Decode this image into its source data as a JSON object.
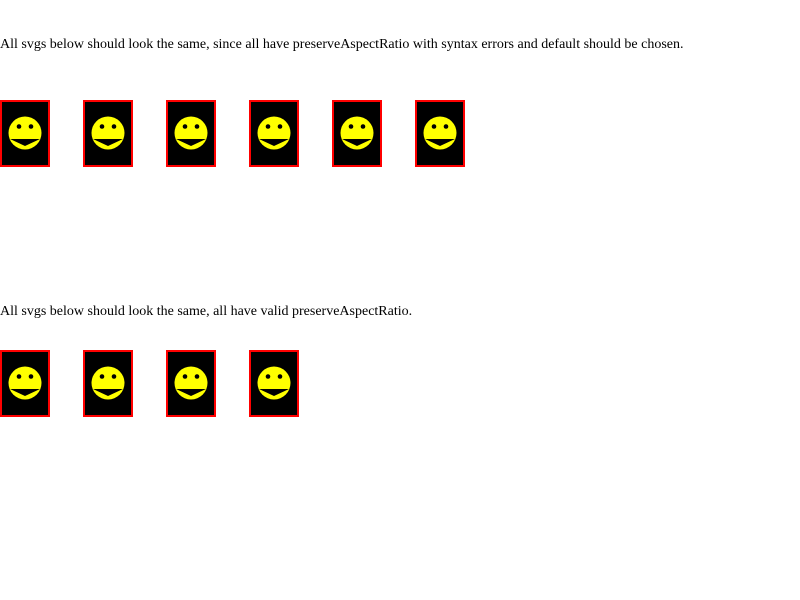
{
  "section1": {
    "caption": "All svgs below should look the same, since all have preserveAspectRatio with syntax errors and default should be chosen.",
    "items": [
      {
        "icon": "smiley-face-icon"
      },
      {
        "icon": "smiley-face-icon"
      },
      {
        "icon": "smiley-face-icon"
      },
      {
        "icon": "smiley-face-icon"
      },
      {
        "icon": "smiley-face-icon"
      },
      {
        "icon": "smiley-face-icon"
      }
    ]
  },
  "section2": {
    "caption": "All svgs below should look the same, all have valid preserveAspectRatio.",
    "items": [
      {
        "icon": "smiley-face-icon"
      },
      {
        "icon": "smiley-face-icon"
      },
      {
        "icon": "smiley-face-icon"
      },
      {
        "icon": "smiley-face-icon"
      }
    ]
  },
  "colors": {
    "frame_border": "#ff0000",
    "frame_background": "#000000",
    "face_fill": "#ffff00",
    "feature_fill": "#000000"
  }
}
